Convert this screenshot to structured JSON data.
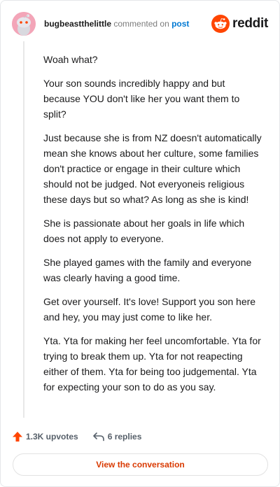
{
  "header": {
    "username": "bugbeastthelittle",
    "commented_text": "commented on",
    "post_link": "post",
    "brand_name": "reddit"
  },
  "comment": {
    "paragraphs": [
      "Woah what?",
      "Your son sounds incredibly happy and but because YOU don't like her you want them to split?",
      "Just because she is from NZ doesn't automatically mean she knows about her culture, some families don't practice or engage in their culture which should not be judged. Not everyoneis religious these days but so what? As long as she is kind!",
      "She is passionate about her goals in life which does not apply to everyone.",
      "She played games with the family and everyone was clearly having a good time.",
      "Get over yourself. It's love! Support you son here and hey, you may just come to like her.",
      "Yta. Yta for making her feel uncomfortable. Yta for trying to break them up. Yta for not reapecting either of them. Yta for being too judgemental. Yta for expecting your son to do as you say."
    ]
  },
  "actions": {
    "upvotes": "1.3K upvotes",
    "replies": "6 replies",
    "upvote_icon": "upvote-arrow-icon",
    "reply_icon": "reply-arrow-icon"
  },
  "footer": {
    "view_conversation": "View the conversation"
  },
  "colors": {
    "brand_orange": "#ff4500",
    "link_blue": "#0079d3",
    "button_text": "#d93900"
  }
}
